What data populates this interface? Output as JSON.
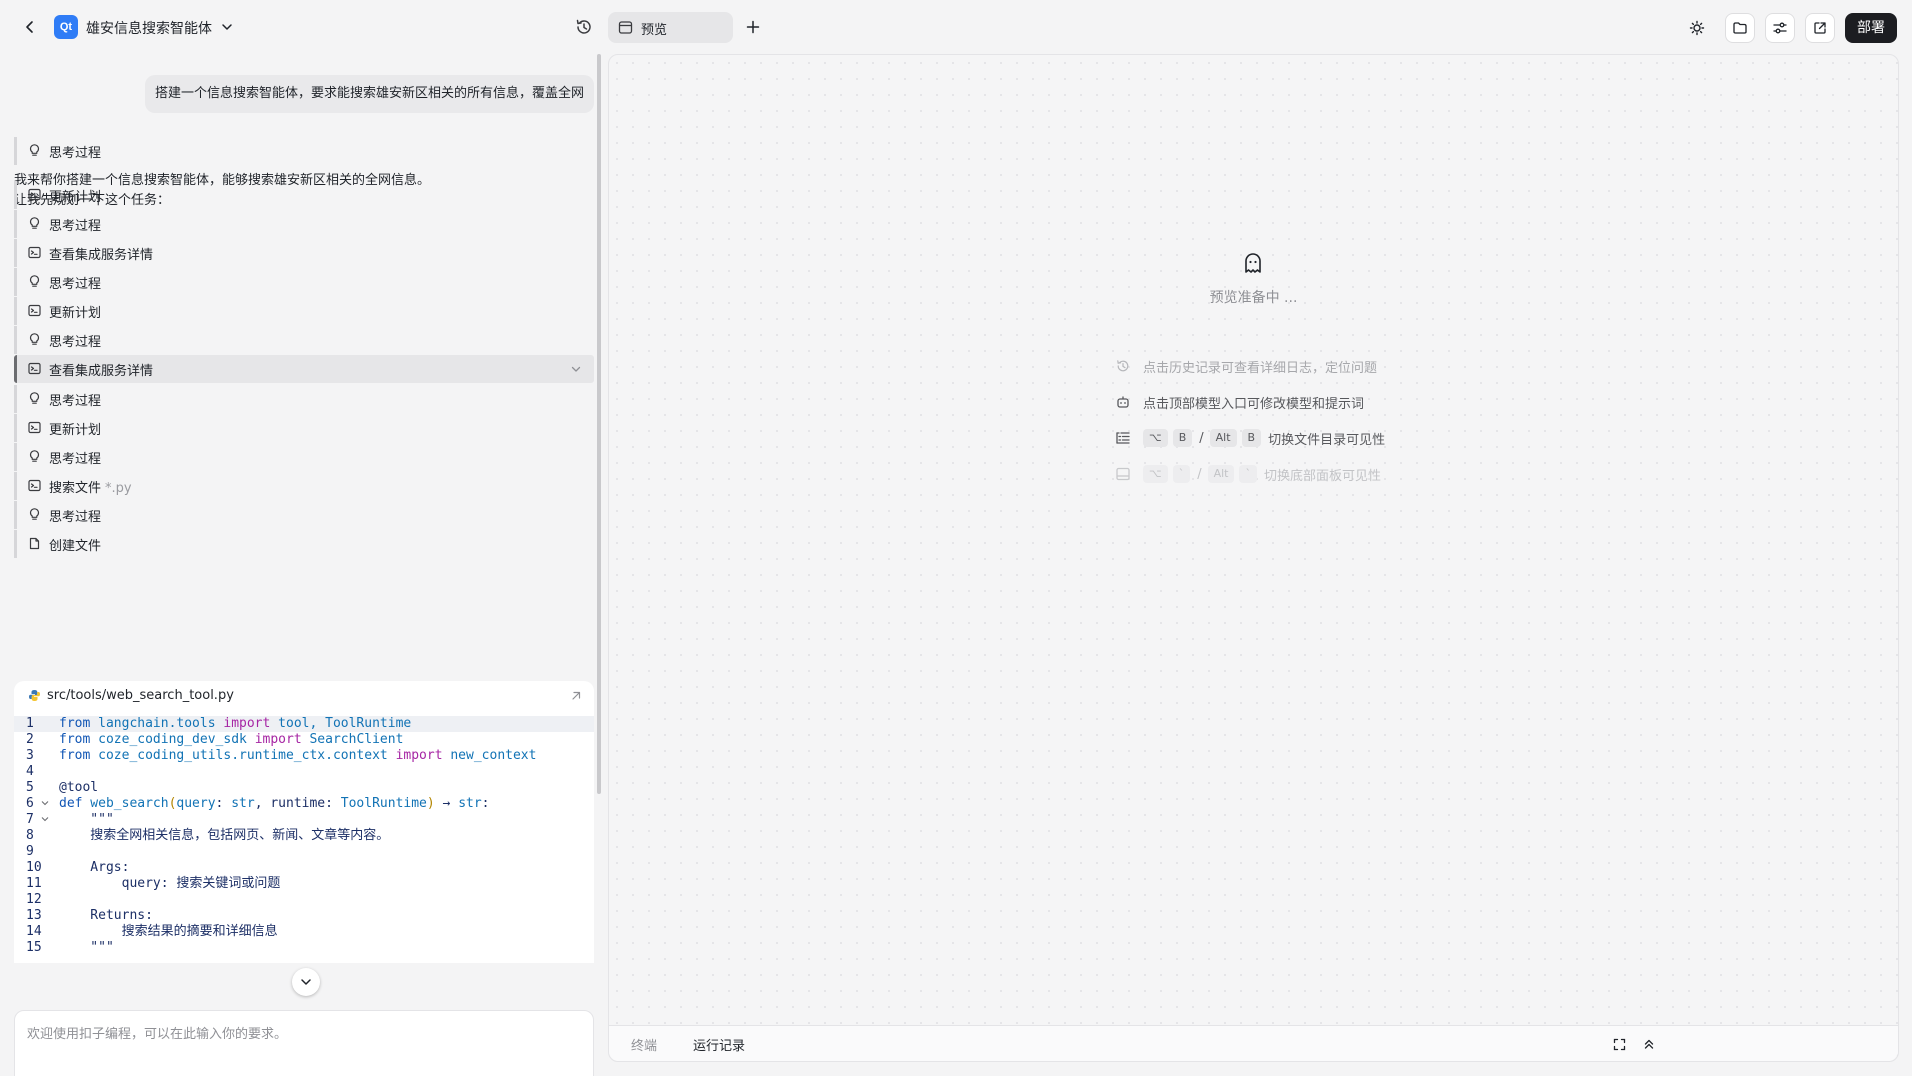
{
  "header": {
    "logo_text": "Qt",
    "project_title": "雄安信息搜索智能体",
    "preview_tab": "预览",
    "deploy_label": "部署"
  },
  "chat": {
    "user_message": "搭建一个信息搜索智能体，要求能搜索雄安新区相关的所有信息，覆盖全网",
    "first_step": "思考过程",
    "intro_line1": "我来帮你搭建一个信息搜索智能体，能够搜索雄安新区相关的全网信息。",
    "intro_line2": "让我先规划一下这个任务：",
    "steps": [
      {
        "label": "更新计划",
        "icon": "terminal-icon"
      },
      {
        "label": "思考过程",
        "icon": "lightbulb-icon"
      },
      {
        "label": "查看集成服务详情",
        "icon": "terminal-icon"
      },
      {
        "label": "思考过程",
        "icon": "lightbulb-icon"
      },
      {
        "label": "更新计划",
        "icon": "terminal-icon"
      },
      {
        "label": "思考过程",
        "icon": "lightbulb-icon"
      },
      {
        "label": "查看集成服务详情",
        "icon": "terminal-icon"
      },
      {
        "label": "思考过程",
        "icon": "lightbulb-icon"
      },
      {
        "label": "更新计划",
        "icon": "terminal-icon"
      },
      {
        "label": "思考过程",
        "icon": "lightbulb-icon"
      },
      {
        "label": "搜索文件",
        "suffix": "*.py",
        "icon": "terminal-icon"
      },
      {
        "label": "思考过程",
        "icon": "lightbulb-icon"
      },
      {
        "label": "创建文件",
        "icon": "file-icon"
      }
    ],
    "code_file": "src/tools/web_search_tool.py",
    "code_lines": [
      {
        "n": "1"
      },
      {
        "n": "2"
      },
      {
        "n": "3"
      },
      {
        "n": "4"
      },
      {
        "n": "5"
      },
      {
        "n": "6"
      },
      {
        "n": "7"
      },
      {
        "n": "8"
      },
      {
        "n": "9"
      },
      {
        "n": "10"
      },
      {
        "n": "11"
      },
      {
        "n": "12"
      },
      {
        "n": "13"
      },
      {
        "n": "14"
      },
      {
        "n": "15"
      }
    ],
    "code": {
      "l1": [
        "from",
        " langchain.tools ",
        "import",
        " tool, ToolRuntime"
      ],
      "l2": [
        "from",
        " coze_coding_dev_sdk ",
        "import",
        " SearchClient"
      ],
      "l3": [
        "from",
        " coze_coding_utils.runtime_ctx.context ",
        "import",
        " new_context"
      ],
      "l5": "@tool",
      "l6": [
        "def",
        " web_search",
        "(",
        "query",
        ": ",
        "str",
        ", runtime: ",
        "ToolRuntime",
        ")",
        " → ",
        "str",
        ":"
      ],
      "l7": "    \"\"\"",
      "l8": "    搜索全网相关信息，包括网页、新闻、文章等内容。",
      "l10": "    Args:",
      "l11": "        query: 搜索关键词或问题",
      "l13": "    Returns:",
      "l14": "        搜索结果的摘要和详细信息",
      "l15": "    \"\"\""
    },
    "input_placeholder": "欢迎使用扣子编程，可以在此输入你的要求。"
  },
  "preview": {
    "status": "预览准备中 ...",
    "hints": {
      "h1": "点击历史记录可查看详细日志，定位问题",
      "h2": "点击顶部模型入口可修改模型和提示词",
      "h3": "切换文件目录可见性",
      "h4": "切换底部面板可见性"
    },
    "keys": {
      "opt": "⌥",
      "b": "B",
      "alt": "Alt",
      "tick": "`",
      "slash": "/"
    },
    "bottom_tabs": {
      "terminal": "终端",
      "run_log": "运行记录"
    }
  },
  "colors": {
    "accent": "#2f7cf6",
    "deploy_bg": "#1c1d21",
    "code_string": "#b31d1d",
    "code_keyword": "#a626a4"
  }
}
